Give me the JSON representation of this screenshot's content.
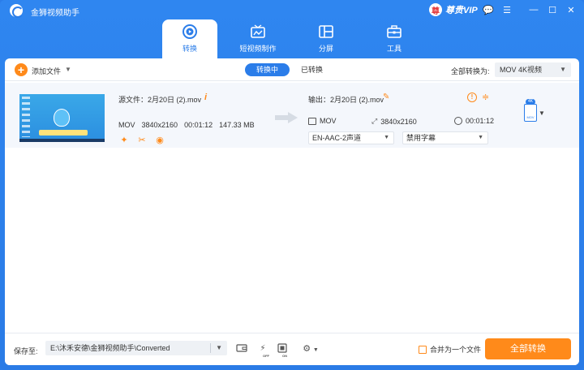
{
  "app": {
    "title": "金狮视频助手",
    "vip_label": "尊贵VIP",
    "vip_badge": "尊"
  },
  "window_controls": {
    "chat": "💬",
    "menu": "☰",
    "minimize": "—",
    "maximize": "☐",
    "close": "✕"
  },
  "nav": {
    "tabs": [
      {
        "label": "转换",
        "icon": "convert-icon",
        "active": true
      },
      {
        "label": "短视频制作",
        "icon": "tv-icon",
        "active": false
      },
      {
        "label": "分屏",
        "icon": "split-screen-icon",
        "active": false
      },
      {
        "label": "工具",
        "icon": "toolbox-icon",
        "active": false
      }
    ]
  },
  "toolbar": {
    "add_icon": "+",
    "add_label": "添加文件",
    "add_caret": "▼",
    "segments": [
      {
        "label": "转换中",
        "active": true
      },
      {
        "label": "已转换",
        "active": false
      }
    ],
    "convert_all_label": "全部转换为:",
    "format_value": "MOV 4K视频",
    "caret": "▼"
  },
  "file": {
    "source_label": "源文件：2月20日 (2).mov",
    "info_icon": "i",
    "src_format": "MOV",
    "src_resolution": "3840x2160",
    "src_duration": "00:01:12",
    "src_size": "147.33 MB",
    "tool_icons": {
      "enhance": "✦",
      "cut": "✂",
      "effect": "◉"
    },
    "output_label": "输出：2月20日 (2).mov",
    "pencil": "✎",
    "out_info": "!",
    "out_split": "≑",
    "out_format": "MOV",
    "out_resolution": "3840x2160",
    "out_duration": "00:01:12",
    "audio_track": "EN-AAC-2声道",
    "subtitle": "禁用字幕",
    "format_badge": "4K",
    "format_badge_text": "MOV",
    "caret": "▼"
  },
  "bottom": {
    "save_label": "保存至:",
    "path": "E:\\沐禾安德\\金狮视频助手\\Converted",
    "caret": "▼",
    "gpu_off_sub": "OFF",
    "hw_on_sub": "ON",
    "merge_label": "合并为一个文件",
    "convert_button": "全部转换"
  },
  "colors": {
    "primary": "#2b7de9",
    "accent": "#ff8a1a"
  }
}
